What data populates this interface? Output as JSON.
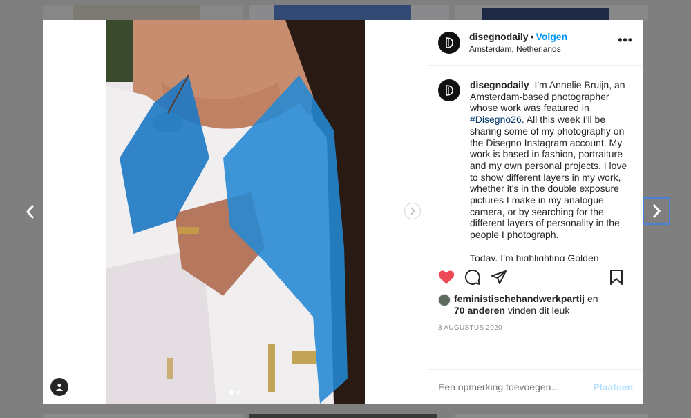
{
  "post": {
    "username": "disegnodaily",
    "separator": "•",
    "follow_label": "Volgen",
    "location": "Amsterdam, Netherlands",
    "more_label": "•••",
    "caption_username": "disegnodaily",
    "caption_part1": "I'm Annelie Bruijn, an Amsterdam-based photographer whose work was featured in",
    "hashtag": "#Disegno26",
    "caption_part2": ". All this week I’ll be sharing some of my photography on the Disegno Instagram account. My work is based in fashion, portraiture and my own personal projects. I love to show different layers in my work, whether it's in the double exposure pictures I make in my analogue camera, or by searching for the different layers of personality in the people I photograph.",
    "caption_para2": "Today, I’m highlighting Golden Joinery, a non-commercial, collaborative clothing brand that was initiated by Saskia van Drimmelen.",
    "liked_by": "feministischehandwerkpartij",
    "likes_conj": "en",
    "others": "70 anderen",
    "likes_suffix": "vinden dit leuk",
    "date": "3 AUGUSTUS 2020"
  },
  "comment_box": {
    "placeholder": "Een opmerking toevoegen...",
    "post_label": "Plaatsen"
  },
  "carousel": {
    "count": 2,
    "active_index": 0
  },
  "icons": {
    "like": "heart-icon",
    "comment": "comment-icon",
    "share": "paper-plane-icon",
    "save": "bookmark-icon",
    "prev": "chevron-left-icon",
    "next": "chevron-right-icon",
    "user_tag": "user-tag-icon"
  },
  "colors": {
    "like": "#ed4956",
    "follow": "#0095f6",
    "hashtag": "#00376b",
    "post_disabled": "#b2dffc"
  }
}
